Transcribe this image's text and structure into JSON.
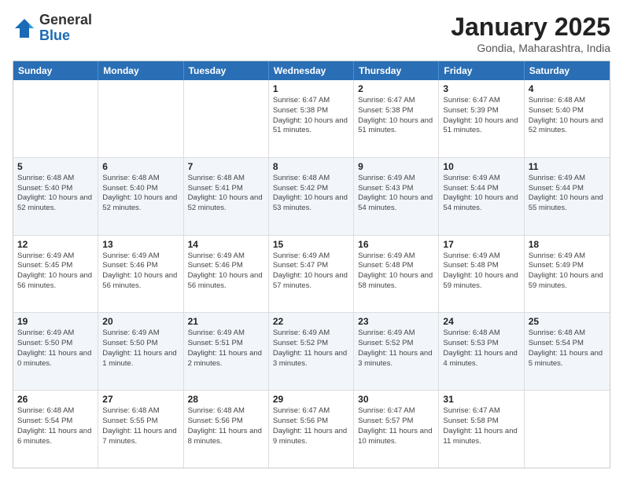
{
  "logo": {
    "general": "General",
    "blue": "Blue"
  },
  "title": "January 2025",
  "subtitle": "Gondia, Maharashtra, India",
  "headers": [
    "Sunday",
    "Monday",
    "Tuesday",
    "Wednesday",
    "Thursday",
    "Friday",
    "Saturday"
  ],
  "rows": [
    [
      {
        "day": "",
        "detail": ""
      },
      {
        "day": "",
        "detail": ""
      },
      {
        "day": "",
        "detail": ""
      },
      {
        "day": "1",
        "detail": "Sunrise: 6:47 AM\nSunset: 5:38 PM\nDaylight: 10 hours and 51 minutes."
      },
      {
        "day": "2",
        "detail": "Sunrise: 6:47 AM\nSunset: 5:38 PM\nDaylight: 10 hours and 51 minutes."
      },
      {
        "day": "3",
        "detail": "Sunrise: 6:47 AM\nSunset: 5:39 PM\nDaylight: 10 hours and 51 minutes."
      },
      {
        "day": "4",
        "detail": "Sunrise: 6:48 AM\nSunset: 5:40 PM\nDaylight: 10 hours and 52 minutes."
      }
    ],
    [
      {
        "day": "5",
        "detail": "Sunrise: 6:48 AM\nSunset: 5:40 PM\nDaylight: 10 hours and 52 minutes."
      },
      {
        "day": "6",
        "detail": "Sunrise: 6:48 AM\nSunset: 5:40 PM\nDaylight: 10 hours and 52 minutes."
      },
      {
        "day": "7",
        "detail": "Sunrise: 6:48 AM\nSunset: 5:41 PM\nDaylight: 10 hours and 52 minutes."
      },
      {
        "day": "8",
        "detail": "Sunrise: 6:48 AM\nSunset: 5:42 PM\nDaylight: 10 hours and 53 minutes."
      },
      {
        "day": "9",
        "detail": "Sunrise: 6:49 AM\nSunset: 5:43 PM\nDaylight: 10 hours and 54 minutes."
      },
      {
        "day": "10",
        "detail": "Sunrise: 6:49 AM\nSunset: 5:44 PM\nDaylight: 10 hours and 54 minutes."
      },
      {
        "day": "11",
        "detail": "Sunrise: 6:49 AM\nSunset: 5:44 PM\nDaylight: 10 hours and 55 minutes."
      }
    ],
    [
      {
        "day": "12",
        "detail": "Sunrise: 6:49 AM\nSunset: 5:45 PM\nDaylight: 10 hours and 56 minutes."
      },
      {
        "day": "13",
        "detail": "Sunrise: 6:49 AM\nSunset: 5:46 PM\nDaylight: 10 hours and 56 minutes."
      },
      {
        "day": "14",
        "detail": "Sunrise: 6:49 AM\nSunset: 5:46 PM\nDaylight: 10 hours and 56 minutes."
      },
      {
        "day": "15",
        "detail": "Sunrise: 6:49 AM\nSunset: 5:47 PM\nDaylight: 10 hours and 57 minutes."
      },
      {
        "day": "16",
        "detail": "Sunrise: 6:49 AM\nSunset: 5:48 PM\nDaylight: 10 hours and 58 minutes."
      },
      {
        "day": "17",
        "detail": "Sunrise: 6:49 AM\nSunset: 5:48 PM\nDaylight: 10 hours and 59 minutes."
      },
      {
        "day": "18",
        "detail": "Sunrise: 6:49 AM\nSunset: 5:49 PM\nDaylight: 10 hours and 59 minutes."
      }
    ],
    [
      {
        "day": "19",
        "detail": "Sunrise: 6:49 AM\nSunset: 5:50 PM\nDaylight: 11 hours and 0 minutes."
      },
      {
        "day": "20",
        "detail": "Sunrise: 6:49 AM\nSunset: 5:50 PM\nDaylight: 11 hours and 1 minute."
      },
      {
        "day": "21",
        "detail": "Sunrise: 6:49 AM\nSunset: 5:51 PM\nDaylight: 11 hours and 2 minutes."
      },
      {
        "day": "22",
        "detail": "Sunrise: 6:49 AM\nSunset: 5:52 PM\nDaylight: 11 hours and 3 minutes."
      },
      {
        "day": "23",
        "detail": "Sunrise: 6:49 AM\nSunset: 5:52 PM\nDaylight: 11 hours and 3 minutes."
      },
      {
        "day": "24",
        "detail": "Sunrise: 6:48 AM\nSunset: 5:53 PM\nDaylight: 11 hours and 4 minutes."
      },
      {
        "day": "25",
        "detail": "Sunrise: 6:48 AM\nSunset: 5:54 PM\nDaylight: 11 hours and 5 minutes."
      }
    ],
    [
      {
        "day": "26",
        "detail": "Sunrise: 6:48 AM\nSunset: 5:54 PM\nDaylight: 11 hours and 6 minutes."
      },
      {
        "day": "27",
        "detail": "Sunrise: 6:48 AM\nSunset: 5:55 PM\nDaylight: 11 hours and 7 minutes."
      },
      {
        "day": "28",
        "detail": "Sunrise: 6:48 AM\nSunset: 5:56 PM\nDaylight: 11 hours and 8 minutes."
      },
      {
        "day": "29",
        "detail": "Sunrise: 6:47 AM\nSunset: 5:56 PM\nDaylight: 11 hours and 9 minutes."
      },
      {
        "day": "30",
        "detail": "Sunrise: 6:47 AM\nSunset: 5:57 PM\nDaylight: 11 hours and 10 minutes."
      },
      {
        "day": "31",
        "detail": "Sunrise: 6:47 AM\nSunset: 5:58 PM\nDaylight: 11 hours and 11 minutes."
      },
      {
        "day": "",
        "detail": ""
      }
    ]
  ]
}
